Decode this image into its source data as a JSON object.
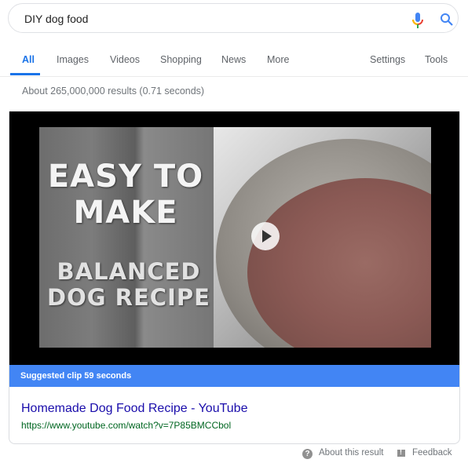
{
  "search": {
    "query": "DIY dog food",
    "mic_icon": "microphone-icon",
    "search_icon": "magnifier-icon"
  },
  "tabs": [
    {
      "label": "All",
      "active": true
    },
    {
      "label": "Images"
    },
    {
      "label": "Videos"
    },
    {
      "label": "Shopping"
    },
    {
      "label": "News"
    },
    {
      "label": "More"
    }
  ],
  "tools": {
    "settings": "Settings",
    "tools": "Tools"
  },
  "stats": "About 265,000,000 results (0.71 seconds)",
  "video": {
    "thumbnail_text_1": "EASY TO MAKE",
    "thumbnail_text_2": "BALANCED DOG RECIPE",
    "play_icon": "play-icon",
    "clip_label": "Suggested clip 59 seconds"
  },
  "result": {
    "title": "Homemade Dog Food Recipe - YouTube",
    "url": "https://www.youtube.com/watch?v=7P85BMCCbol"
  },
  "footer": {
    "about": "About this result",
    "feedback": "Feedback"
  },
  "colors": {
    "accent": "#1a73e8",
    "clip_bar": "#4285f4",
    "link": "#1a0dab",
    "url": "#006621"
  }
}
